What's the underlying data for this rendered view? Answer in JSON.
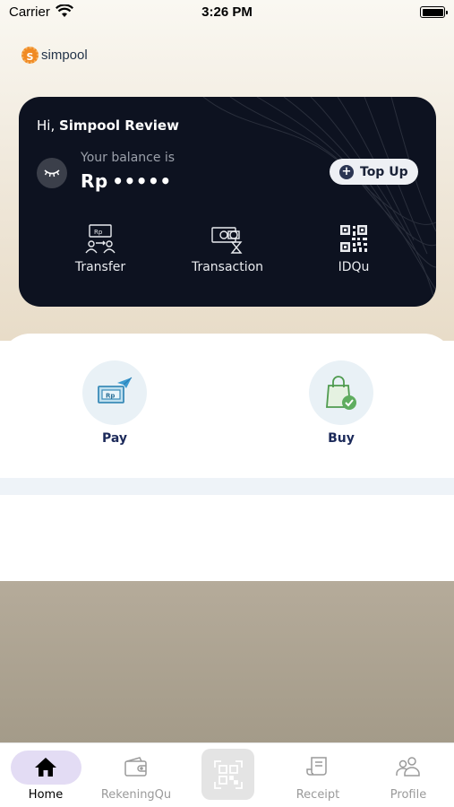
{
  "status_bar": {
    "carrier": "Carrier",
    "time": "3:26 PM"
  },
  "brand": {
    "logo_letter": "S",
    "name": "simpool",
    "accent": "#f08a24"
  },
  "card": {
    "greeting_prefix": "Hi, ",
    "user_name": "Simpool Review",
    "balance_label": "Your balance is",
    "balance_value": "Rp •••••",
    "topup_label": "Top Up",
    "actions": [
      {
        "label": "Transfer",
        "icon": "transfer-icon"
      },
      {
        "label": "Transaction",
        "icon": "transaction-icon"
      },
      {
        "label": "IDQu",
        "icon": "qr-code-icon"
      }
    ]
  },
  "quick": [
    {
      "label": "Pay",
      "icon": "pay-icon"
    },
    {
      "label": "Buy",
      "icon": "shopping-bag-icon"
    }
  ],
  "nav": {
    "items": [
      {
        "label": "Home",
        "icon": "home-icon",
        "active": true
      },
      {
        "label": "RekeningQu",
        "icon": "wallet-icon"
      },
      {
        "label": "",
        "icon": "scan-qr-icon"
      },
      {
        "label": "Receipt",
        "icon": "receipt-icon"
      },
      {
        "label": "Profile",
        "icon": "profile-icon"
      }
    ]
  }
}
